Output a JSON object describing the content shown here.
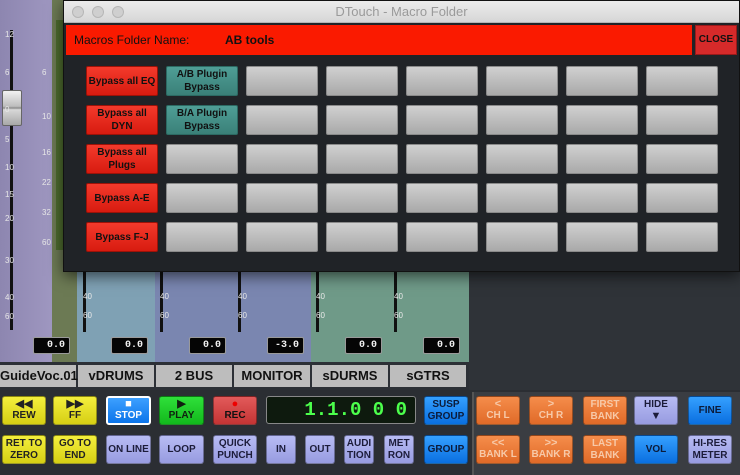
{
  "window": {
    "title": "DTouch - Macro Folder",
    "name_label": "Macros Folder Name:",
    "folder_name": "AB tools",
    "close_label": "CLOSE"
  },
  "macros": [
    [
      {
        "label": "Bypass all EQ",
        "color": "red"
      },
      {
        "label": "A/B Plugin Bypass",
        "color": "teal"
      },
      {
        "label": "",
        "color": "grey"
      },
      {
        "label": "",
        "color": "grey"
      },
      {
        "label": "",
        "color": "grey"
      },
      {
        "label": "",
        "color": "grey"
      },
      {
        "label": "",
        "color": "grey"
      },
      {
        "label": "",
        "color": "grey"
      }
    ],
    [
      {
        "label": "Bypass all DYN",
        "color": "red"
      },
      {
        "label": "B/A Plugin Bypass",
        "color": "teal"
      },
      {
        "label": "",
        "color": "grey"
      },
      {
        "label": "",
        "color": "grey"
      },
      {
        "label": "",
        "color": "grey"
      },
      {
        "label": "",
        "color": "grey"
      },
      {
        "label": "",
        "color": "grey"
      },
      {
        "label": "",
        "color": "grey"
      }
    ],
    [
      {
        "label": "Bypass all Plugs",
        "color": "red"
      },
      {
        "label": "",
        "color": "grey"
      },
      {
        "label": "",
        "color": "grey"
      },
      {
        "label": "",
        "color": "grey"
      },
      {
        "label": "",
        "color": "grey"
      },
      {
        "label": "",
        "color": "grey"
      },
      {
        "label": "",
        "color": "grey"
      },
      {
        "label": "",
        "color": "grey"
      }
    ],
    [
      {
        "label": "Bypass A-E",
        "color": "red"
      },
      {
        "label": "",
        "color": "grey"
      },
      {
        "label": "",
        "color": "grey"
      },
      {
        "label": "",
        "color": "grey"
      },
      {
        "label": "",
        "color": "grey"
      },
      {
        "label": "",
        "color": "grey"
      },
      {
        "label": "",
        "color": "grey"
      },
      {
        "label": "",
        "color": "grey"
      }
    ],
    [
      {
        "label": "Bypass F-J",
        "color": "red"
      },
      {
        "label": "",
        "color": "grey"
      },
      {
        "label": "",
        "color": "grey"
      },
      {
        "label": "",
        "color": "grey"
      },
      {
        "label": "",
        "color": "grey"
      },
      {
        "label": "",
        "color": "grey"
      },
      {
        "label": "",
        "color": "grey"
      },
      {
        "label": "",
        "color": "grey"
      }
    ]
  ],
  "mixer": {
    "first_scale": [
      "12",
      "6",
      "0",
      "5",
      "10",
      "15",
      "20",
      "30",
      "40",
      "60"
    ],
    "meter_scale": [
      "6",
      "10",
      "16",
      "22",
      "32",
      "60"
    ],
    "short_scale": [
      "40",
      "60"
    ],
    "strips": [
      {
        "name": "GuideVoc.01",
        "value": "0.0"
      },
      {
        "name": "vDRUMS",
        "value": "0.0"
      },
      {
        "name": "2 BUS",
        "value": "0.0"
      },
      {
        "name": "MONITOR",
        "value": "-3.0"
      },
      {
        "name": "sDURMS",
        "value": "0.0"
      },
      {
        "name": "sGTRS",
        "value": "0.0"
      }
    ]
  },
  "transport": {
    "rew": "REW",
    "ff": "FF",
    "stop": "STOP",
    "play": "PLAY",
    "rec": "REC",
    "counter": "1.1.0 0 0",
    "susp_group": "SUSP GROUP",
    "group": "GROUP",
    "ch_l": "CH L",
    "ch_r": "CH R",
    "first_bank": "FIRST BANK",
    "hide": "HIDE",
    "fine": "FINE",
    "bank_l": "BANK L",
    "bank_r": "BANK R",
    "last_bank": "LAST BANK",
    "vol": "VOL",
    "hi_res_meter": "HI-RES METER",
    "ret_to_zero": "RET TO ZERO",
    "go_to_end": "GO TO END",
    "on_line": "ON LINE",
    "loop": "LOOP",
    "quick_punch": "QUICK PUNCH",
    "in": "IN",
    "out": "OUT",
    "audition": "AUDI TION",
    "meter_on": "MET RON"
  },
  "colors": {
    "accent_red": "#fa1a00",
    "teal": "#3a8078",
    "lcd_green": "#4cff4c"
  }
}
